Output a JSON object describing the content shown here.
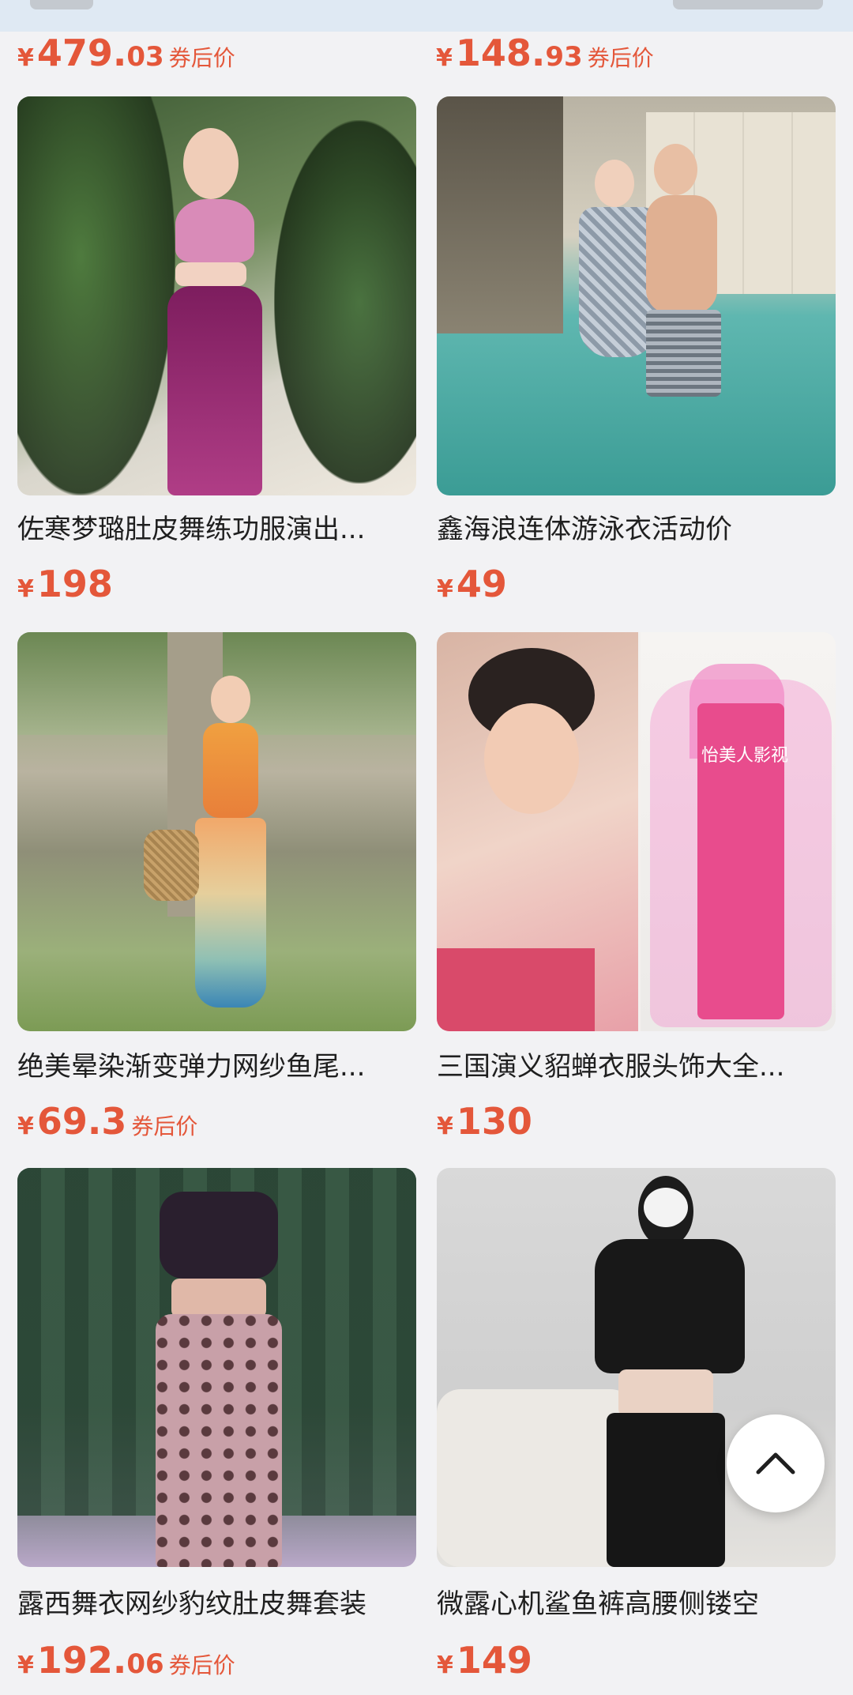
{
  "top_prices": [
    {
      "yen": "¥",
      "int": "479.",
      "dec": "03",
      "suffix": "券后价"
    },
    {
      "yen": "¥",
      "int": "148.",
      "dec": "93",
      "suffix": "券后价"
    }
  ],
  "products": [
    {
      "title": "佐寒梦璐肚皮舞练功服演出...",
      "yen": "¥",
      "int": "198",
      "dec": "",
      "suffix": "",
      "image": "sequin-dance-outfit"
    },
    {
      "title": "鑫海浪连体游泳衣活动价",
      "yen": "¥",
      "int": "49",
      "dec": "",
      "suffix": "",
      "image": "couple-swimwear-poolside"
    },
    {
      "title": "绝美晕染渐变弹力网纱鱼尾...",
      "yen": "¥",
      "int": "69.3",
      "dec": "",
      "suffix": "券后价",
      "image": "gradient-mesh-fishtail-dress"
    },
    {
      "title": "三国演义貂蝉衣服头饰大全...",
      "yen": "¥",
      "int": "130",
      "dec": "",
      "suffix": "",
      "image": "costume-pink-gown",
      "watermark": "怡美人影视"
    },
    {
      "title": "露西舞衣网纱豹纹肚皮舞套装",
      "yen": "¥",
      "int": "192.",
      "dec": "06",
      "suffix": "券后价",
      "image": "leopard-belly-dance-set"
    },
    {
      "title": "微露心机鲨鱼裤高腰侧镂空",
      "yen": "¥",
      "int": "149",
      "dec": "",
      "suffix": "",
      "image": "black-crop-top-shark-pants"
    }
  ],
  "back_to_top": {
    "icon": "chevron-up-icon"
  }
}
